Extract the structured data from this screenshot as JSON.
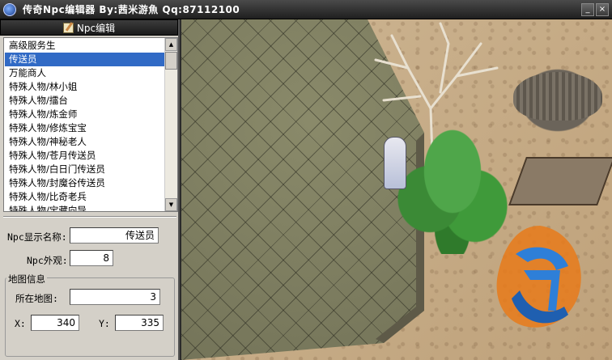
{
  "window": {
    "title": "传奇Npc编辑器 By:茜米游魚 Qq:87112100",
    "minimize_label": "_",
    "close_label": "×"
  },
  "panel": {
    "header": "Npc编辑"
  },
  "npc_list": {
    "items": [
      "高级服务生",
      "传送员",
      "万能商人",
      "特殊人物/林小姐",
      "特殊人物/擂台",
      "特殊人物/炼金师",
      "特殊人物/修炼宝宝",
      "特殊人物/神秘老人",
      "特殊人物/苍月传送员",
      "特殊人物/白日门传送员",
      "特殊人物/封魔谷传送员",
      "特殊人物/比奇老兵",
      "特殊人物/宝藏向导"
    ],
    "selected_index": 1
  },
  "form": {
    "display_name_label": "Npc显示名称:",
    "display_name_value": "传送员",
    "appearance_label": "Npc外观:",
    "appearance_value": "8",
    "map_group_title": "地图信息",
    "map_label": "所在地图:",
    "map_value": "3",
    "x_label": "X:",
    "x_value": "340",
    "y_label": "Y:",
    "y_value": "335"
  },
  "colors": {
    "selection": "#316ac5",
    "panel_bg": "#d4d0c8"
  }
}
